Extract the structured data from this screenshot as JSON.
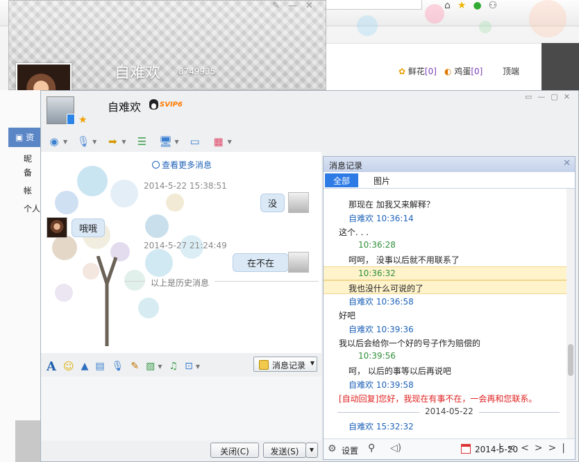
{
  "profile": {
    "name": "自难欢",
    "qq": "8749935"
  },
  "side": {
    "tab": "资",
    "items": [
      "昵",
      "备",
      "帐",
      "个人"
    ]
  },
  "browser": {
    "flower_label": "鲜花",
    "flower_count": "[0]",
    "egg_label": "鸡蛋",
    "egg_count": "[0]",
    "top_label": "顶端"
  },
  "chat": {
    "name": "自难欢",
    "badge": "SVIP6",
    "more": "查看更多消息",
    "ts1": "2014-5-22 15:38:51",
    "ts2": "2014-5-27 21:24:49",
    "msg1": "没",
    "msg2": "哦哦",
    "msg3": "在不在",
    "hist_sep": "以上是历史消息",
    "history_btn": "消息记录",
    "close": "关闭(C)",
    "send": "发送(S)"
  },
  "history": {
    "title": "消息记录",
    "tab_all": "全部",
    "tab_pic": "图片",
    "rows": [
      {
        "text": "那现在 加我又来解释？",
        "cls": "",
        "indent": 36
      },
      {
        "text": "自难欢 10:36:14",
        "cls": "c-blue",
        "indent": 36
      },
      {
        "text": "这个. . .",
        "cls": "",
        "indent": 22
      },
      {
        "text": "10:36:28",
        "cls": "c-green",
        "indent": 50
      },
      {
        "text": "呵呵， 没事以后就不用联系了",
        "cls": "",
        "indent": 36
      },
      {
        "text": "10:36:32",
        "cls": "c-green",
        "indent": 50
      },
      {
        "text": "我也没什么可说的了",
        "cls": "",
        "indent": 36
      },
      {
        "text": "自难欢 10:36:58",
        "cls": "c-blue",
        "indent": 36
      },
      {
        "text": "好吧",
        "cls": "",
        "indent": 22
      },
      {
        "text": "自难欢 10:39:36",
        "cls": "c-blue",
        "indent": 36
      },
      {
        "text": "我以后会给你一个好的号子作为赔偿的",
        "cls": "",
        "indent": 22
      },
      {
        "text": "10:39:56",
        "cls": "c-green",
        "indent": 50
      },
      {
        "text": "呵， 以后的事等以后再说吧",
        "cls": "",
        "indent": 36
      },
      {
        "text": "自难欢 10:39:58",
        "cls": "c-blue",
        "indent": 36
      },
      {
        "text": "[自动回复]您好，我现在有事不在，一会再和您联系。",
        "cls": "c-red",
        "indent": 22
      },
      {
        "text": "2014-05-22",
        "cls": "date",
        "indent": 0
      },
      {
        "text": "自难欢 15:32:32",
        "cls": "c-blue",
        "indent": 36
      }
    ],
    "settings": "设置",
    "date": "2014-5-20"
  },
  "colors": {
    "accent": "#2f7be6",
    "link": "#1d62b8",
    "time_green": "#2f8f3a",
    "auto_reply": "#e02020",
    "highlight": "#fff3cc"
  }
}
